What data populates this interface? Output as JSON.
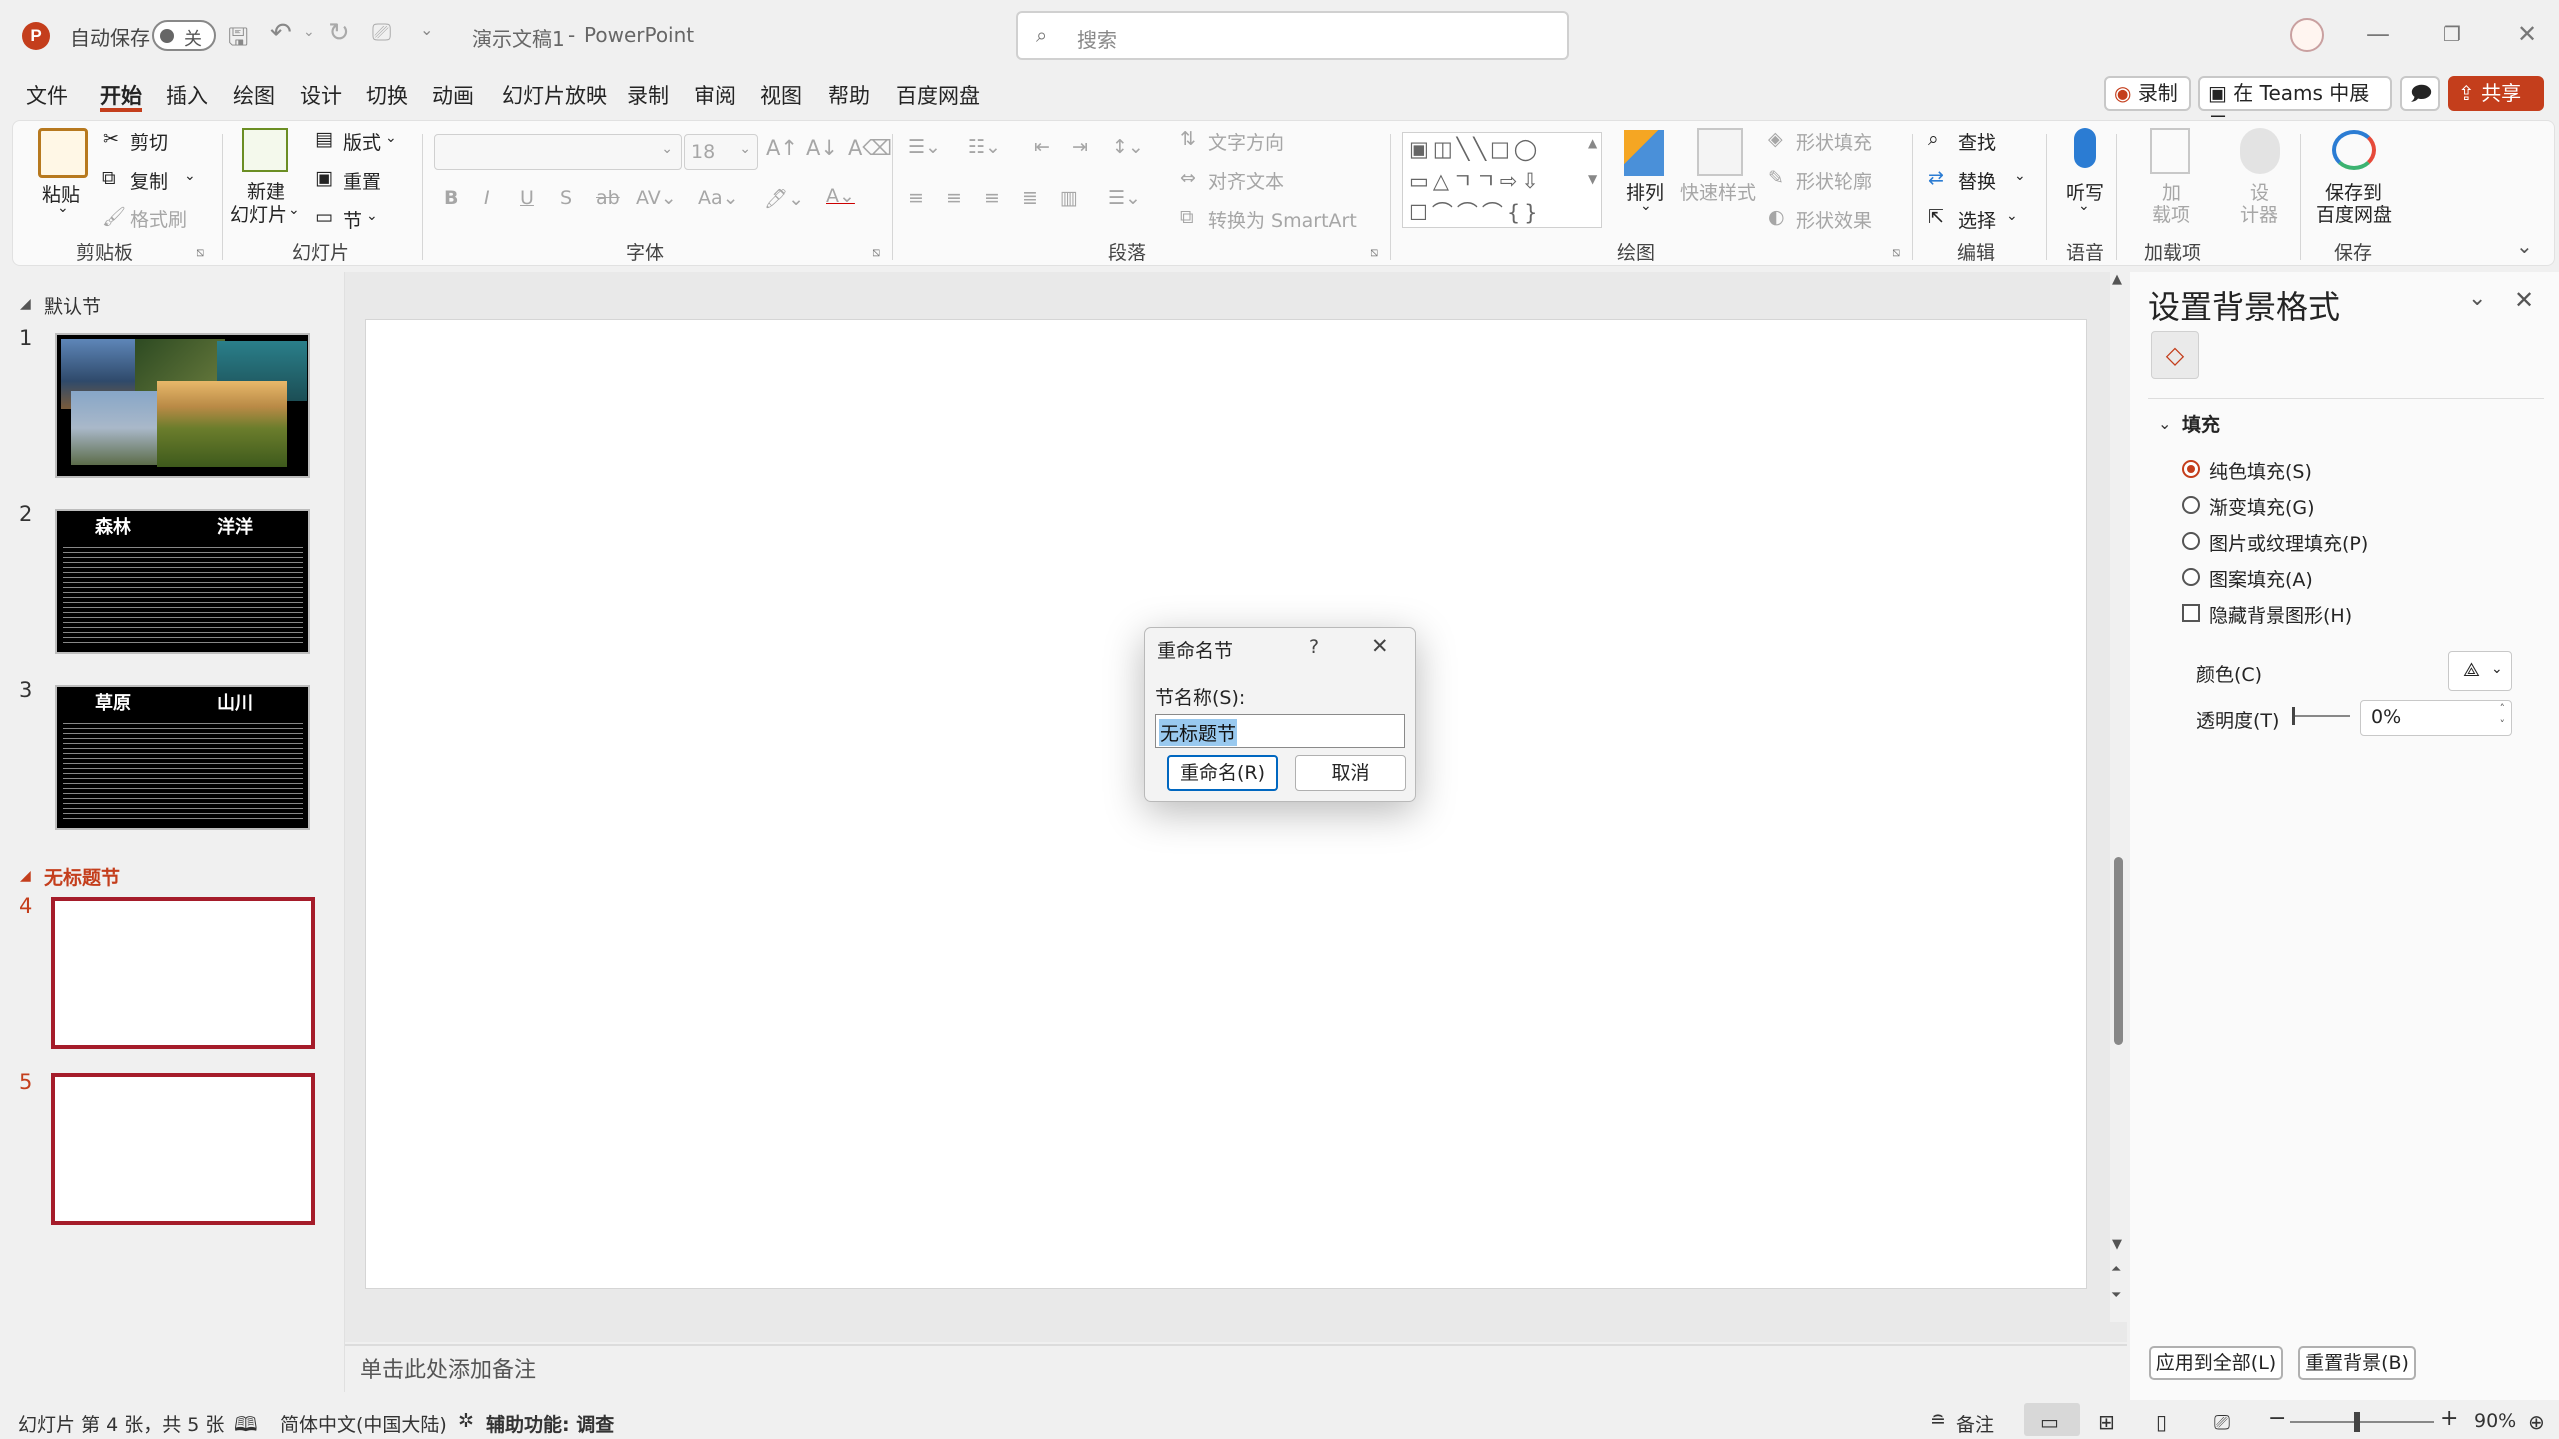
{
  "title_bar": {
    "logo": "P",
    "autosave_label": "自动保存",
    "autosave_state": "关",
    "doc_title": "演示文稿1",
    "separator": "-",
    "app_name": "PowerPoint",
    "search_placeholder": "搜索"
  },
  "menu": {
    "tabs": [
      "文件",
      "开始",
      "插入",
      "绘图",
      "设计",
      "切换",
      "动画",
      "幻灯片放映",
      "录制",
      "审阅",
      "视图",
      "帮助",
      "百度网盘"
    ],
    "active": "开始",
    "record_button": "录制",
    "teams_button": "在 Teams 中展示",
    "share_button": "共享"
  },
  "ribbon": {
    "clipboard": {
      "paste": "粘贴",
      "cut": "剪切",
      "copy": "复制",
      "format_painter": "格式刷",
      "group": "剪贴板"
    },
    "slides": {
      "new_slide_1": "新建",
      "new_slide_2": "幻灯片",
      "layout": "版式",
      "reset": "重置",
      "section": "节",
      "group": "幻灯片"
    },
    "font": {
      "size": "18",
      "group": "字体"
    },
    "paragraph": {
      "text_direction": "文字方向",
      "align_text": "对齐文本",
      "smartart": "转换为 SmartArt",
      "group": "段落"
    },
    "drawing": {
      "arrange": "排列",
      "quick_styles": "快速样式",
      "shape_fill": "形状填充",
      "shape_outline": "形状轮廓",
      "shape_effects": "形状效果",
      "group": "绘图"
    },
    "editing": {
      "find": "查找",
      "replace": "替换",
      "select": "选择",
      "group": "编辑"
    },
    "voice": {
      "dictate": "听写",
      "group": "语音"
    },
    "addins": {
      "addins_1": "加",
      "addins_2": "载项",
      "designer_1": "设",
      "designer_2": "计器",
      "group": "加载项"
    },
    "save": {
      "save_1": "保存到",
      "save_2": "百度网盘",
      "group": "保存"
    }
  },
  "slide_panel": {
    "section1": "默认节",
    "section2": "无标题节",
    "slides": [
      {
        "num": "1"
      },
      {
        "num": "2",
        "left_title": "森林",
        "right_title": "洋洋"
      },
      {
        "num": "3",
        "left_title": "草原",
        "right_title": "山川"
      },
      {
        "num": "4"
      },
      {
        "num": "5"
      }
    ]
  },
  "notes_placeholder": "单击此处添加备注",
  "format_pane": {
    "title": "设置背景格式",
    "fill_header": "填充",
    "options": [
      "纯色填充(S)",
      "渐变填充(G)",
      "图片或纹理填充(P)",
      "图案填充(A)"
    ],
    "selected_option": 0,
    "hide_bg": "隐藏背景图形(H)",
    "color_label": "颜色(C)",
    "transparency_label": "透明度(T)",
    "transparency_value": "0%",
    "apply_all": "应用到全部(L)",
    "reset_bg": "重置背景(B)"
  },
  "dialog": {
    "title": "重命名节",
    "help": "?",
    "field_label": "节名称(S):",
    "field_value": "无标题节",
    "ok": "重命名(R)",
    "cancel": "取消"
  },
  "status_bar": {
    "slide_info": "幻灯片 第 4 张，共 5 张",
    "language": "简体中文(中国大陆)",
    "accessibility": "辅助功能: 调查",
    "notes": "备注",
    "zoom": "90%"
  },
  "colors": {
    "accent": "#c43e1c",
    "selection": "#a51c2a"
  }
}
